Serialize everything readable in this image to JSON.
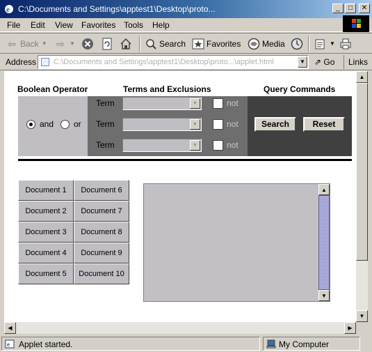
{
  "window": {
    "title": "C:\\Documents and Settings\\apptest1\\Desktop\\proto..."
  },
  "menubar": {
    "items": [
      "File",
      "Edit",
      "View",
      "Favorites",
      "Tools",
      "Help"
    ]
  },
  "toolbar": {
    "back_label": "Back",
    "search_label": "Search",
    "favorites_label": "Favorites",
    "media_label": "Media"
  },
  "addressbar": {
    "label": "Address",
    "value": "C:\\Documents and Settings\\apptest1\\Desktop\\proto...\\applet.html",
    "go_label": "Go",
    "links_label": "Links"
  },
  "applet": {
    "headers": {
      "boolean_operator": "Boolean Operator",
      "terms_exclusions": "Terms and Exclusions",
      "query_commands": "Query Commands"
    },
    "operators": {
      "and_label": "and",
      "or_label": "or",
      "selected": "and"
    },
    "terms": [
      {
        "label": "Term",
        "value": "",
        "not_label": "not",
        "not_checked": false
      },
      {
        "label": "Term",
        "value": "",
        "not_label": "not",
        "not_checked": false
      },
      {
        "label": "Term",
        "value": "",
        "not_label": "not",
        "not_checked": false
      }
    ],
    "search_label": "Search",
    "reset_label": "Reset",
    "documents": [
      "Document 1",
      "Document 2",
      "Document 3",
      "Document 4",
      "Document 5",
      "Document 6",
      "Document 7",
      "Document 8",
      "Document 9",
      "Document 10"
    ]
  },
  "statusbar": {
    "text": "Applet started.",
    "zone": "My Computer"
  },
  "colors": {
    "operator_band": "#c0bdc3",
    "terms_band": "#6e6e6e",
    "commands_band": "#404040"
  }
}
